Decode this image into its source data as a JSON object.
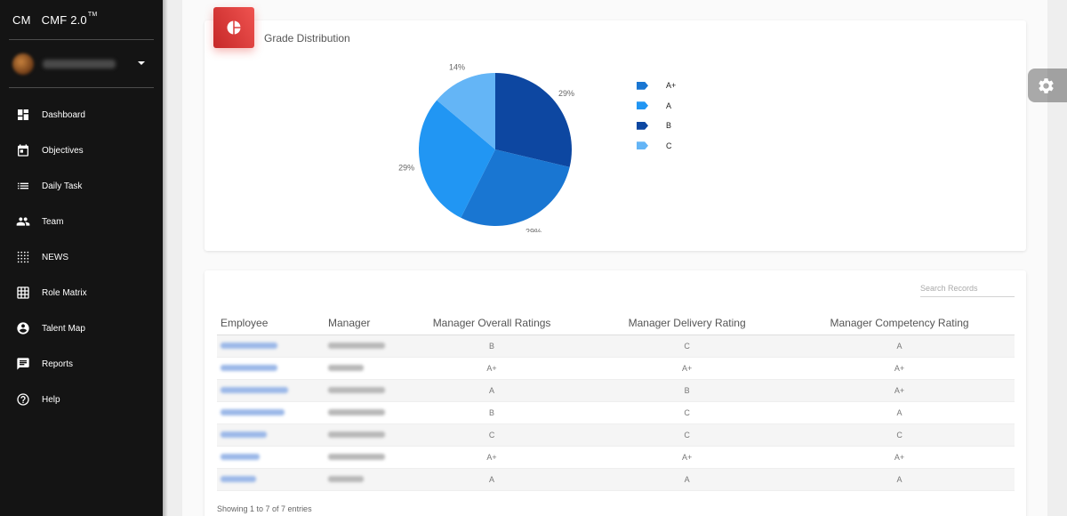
{
  "app": {
    "logo_mini": "CM",
    "logo_full": "CMF 2.0",
    "logo_tm": "TM"
  },
  "sidebar": {
    "items": [
      {
        "label": "Dashboard",
        "icon": "dashboard-icon"
      },
      {
        "label": "Objectives",
        "icon": "calendar-icon"
      },
      {
        "label": "Daily Task",
        "icon": "list-icon"
      },
      {
        "label": "Team",
        "icon": "people-icon"
      },
      {
        "label": "NEWS",
        "icon": "dots-grid-icon"
      },
      {
        "label": "Role Matrix",
        "icon": "grid-icon"
      },
      {
        "label": "Talent Map",
        "icon": "account-circle-icon"
      },
      {
        "label": "Reports",
        "icon": "chat-report-icon"
      },
      {
        "label": "Help",
        "icon": "help-circle-icon"
      }
    ]
  },
  "grade_card": {
    "title": "Grade Distribution",
    "icon": "pie-chart-icon"
  },
  "chart_data": {
    "type": "pie",
    "title": "Grade Distribution",
    "categories": [
      "A+",
      "A",
      "B",
      "C"
    ],
    "values": [
      29,
      29,
      29,
      14
    ],
    "value_labels": [
      "29%",
      "29%",
      "29%",
      "14%"
    ],
    "colors": [
      "#0d47a1",
      "#1976d2",
      "#2196f3",
      "#64b5f6"
    ],
    "legend_colors": [
      "#1976d2",
      "#2196f3",
      "#0d47a1",
      "#64b5f6"
    ],
    "legend_placement": "right"
  },
  "table": {
    "search_placeholder": "Search Records",
    "headers": [
      "Employee",
      "Manager",
      "Manager Overall Ratings",
      "Manager Delivery Rating",
      "Manager Competency Rating"
    ],
    "rows": [
      {
        "overall": "B",
        "delivery": "C",
        "competency": "A"
      },
      {
        "overall": "A+",
        "delivery": "A+",
        "competency": "A+"
      },
      {
        "overall": "A",
        "delivery": "B",
        "competency": "A+"
      },
      {
        "overall": "B",
        "delivery": "C",
        "competency": "A"
      },
      {
        "overall": "C",
        "delivery": "C",
        "competency": "C"
      },
      {
        "overall": "A+",
        "delivery": "A+",
        "competency": "A+"
      },
      {
        "overall": "A",
        "delivery": "A",
        "competency": "A"
      }
    ],
    "info": "Showing 1 to 7 of 7 entries"
  },
  "settings": {
    "icon": "gear-icon"
  }
}
